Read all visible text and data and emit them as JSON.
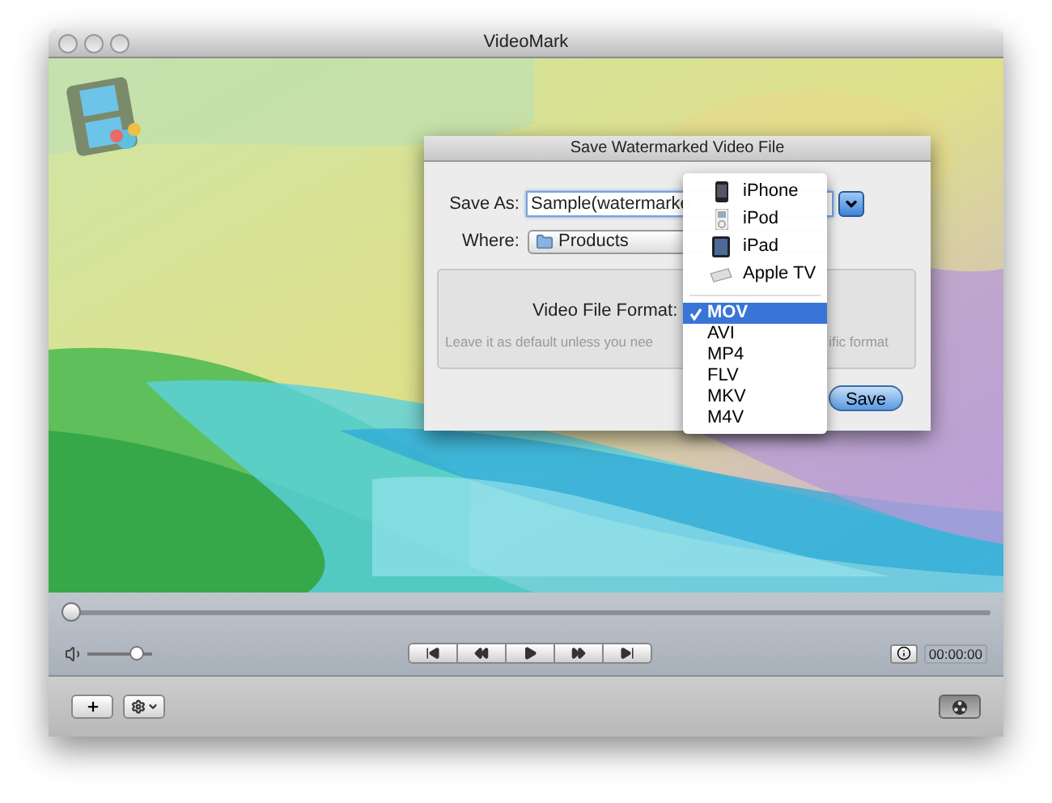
{
  "window": {
    "title": "VideoMark"
  },
  "dialog": {
    "title": "Save Watermarked Video File",
    "save_as_label": "Save As:",
    "save_as_value": "Sample(watermarke",
    "where_label": "Where:",
    "where_value": "Products",
    "format_label": "Video File Format:",
    "hint_parts": [
      "Leave it as default unless you nee",
      "ific format"
    ],
    "save_button": "Save"
  },
  "format_menu": {
    "devices": [
      {
        "label": "iPhone",
        "kind": "phone"
      },
      {
        "label": "iPod",
        "kind": "player"
      },
      {
        "label": "iPad",
        "kind": "tablet"
      },
      {
        "label": "Apple TV",
        "kind": "tv"
      }
    ],
    "formats": [
      {
        "label": "MOV",
        "selected": true
      },
      {
        "label": "AVI",
        "selected": false
      },
      {
        "label": "MP4",
        "selected": false
      },
      {
        "label": "FLV",
        "selected": false
      },
      {
        "label": "MKV",
        "selected": false
      },
      {
        "label": "M4V",
        "selected": false
      }
    ]
  },
  "player": {
    "seek": {
      "level": 0
    },
    "volume": {
      "level": 0.85
    },
    "transport": [
      {
        "kind": "skip-back"
      },
      {
        "kind": "rewind"
      },
      {
        "kind": "play"
      },
      {
        "kind": "fast-forward"
      },
      {
        "kind": "skip-forward"
      }
    ],
    "time": "00:00:00"
  }
}
